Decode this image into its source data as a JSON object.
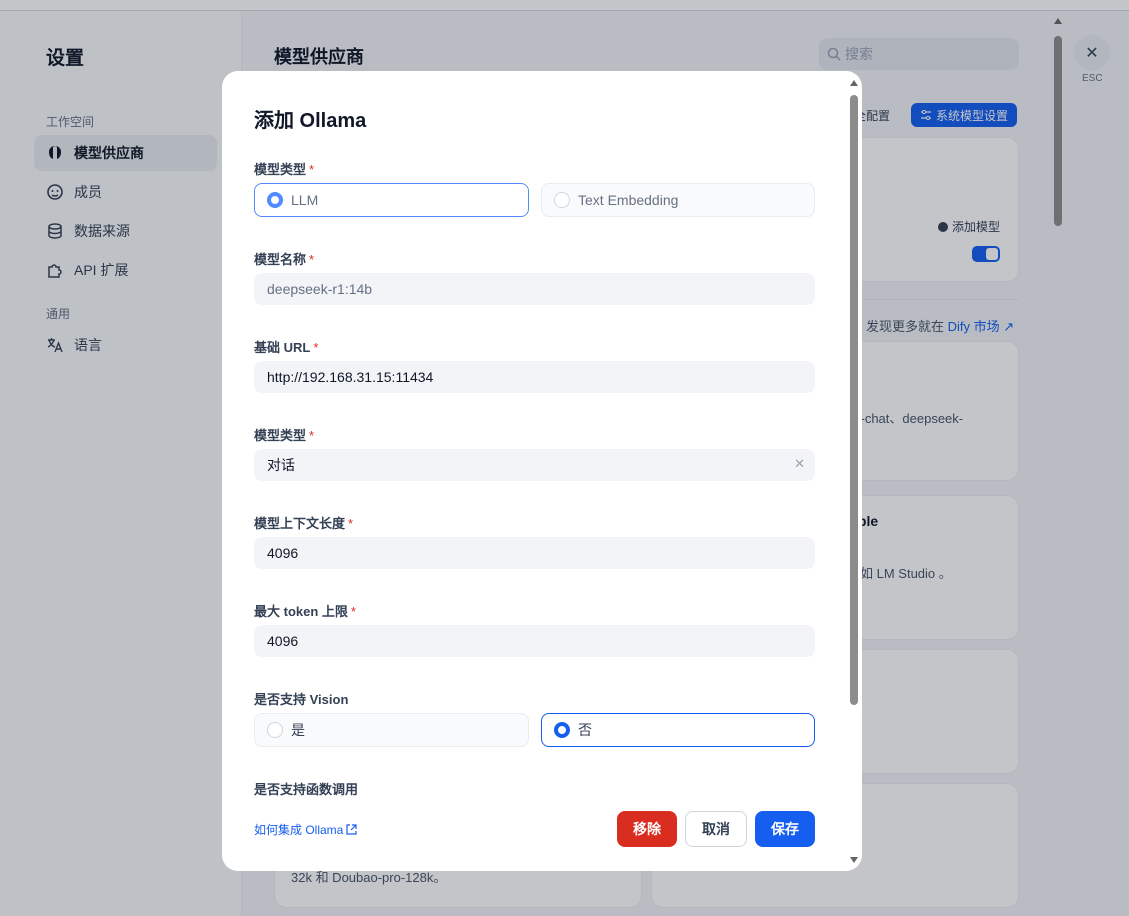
{
  "sidebar": {
    "title": "设置",
    "workspace_label": "工作空间",
    "items": [
      {
        "label": "模型供应商",
        "icon": "brain-icon"
      },
      {
        "label": "成员",
        "icon": "members-icon"
      },
      {
        "label": "数据来源",
        "icon": "database-icon"
      },
      {
        "label": "API 扩展",
        "icon": "puzzle-icon"
      }
    ],
    "general_label": "通用",
    "language_label": "语言"
  },
  "main": {
    "title": "模型供应商",
    "search_placeholder": "搜索",
    "config_text": "完全配置",
    "system_model_button": "系统模型设置",
    "add_model_label": "添加模型",
    "market_text": "发现更多就在",
    "market_link": "Dify 市场",
    "snippet1": "k-chat、deepseek-",
    "snippet2": "ible",
    "snippet3": "如 LM Studio 。",
    "snippet4": "32k 和 Doubao-pro-128k。",
    "esc_label": "ESC"
  },
  "modal": {
    "title": "添加 Ollama",
    "model_type": {
      "label": "模型类型",
      "options": [
        "LLM",
        "Text Embedding"
      ],
      "selected": "LLM"
    },
    "model_name": {
      "label": "模型名称",
      "placeholder": "deepseek-r1:14b"
    },
    "base_url": {
      "label": "基础 URL",
      "value": "http://192.168.31.15:11434"
    },
    "completion_type": {
      "label": "模型类型",
      "value": "对话"
    },
    "context_length": {
      "label": "模型上下文长度",
      "value": "4096"
    },
    "max_tokens": {
      "label": "最大 token 上限",
      "value": "4096"
    },
    "vision": {
      "label": "是否支持 Vision",
      "options": [
        "是",
        "否"
      ],
      "selected": "否"
    },
    "function_call": {
      "label": "是否支持函数调用"
    },
    "help_link": "如何集成 Ollama",
    "buttons": {
      "remove": "移除",
      "cancel": "取消",
      "save": "保存"
    }
  },
  "colors": {
    "primary": "#155eef",
    "danger": "#d92d20"
  }
}
